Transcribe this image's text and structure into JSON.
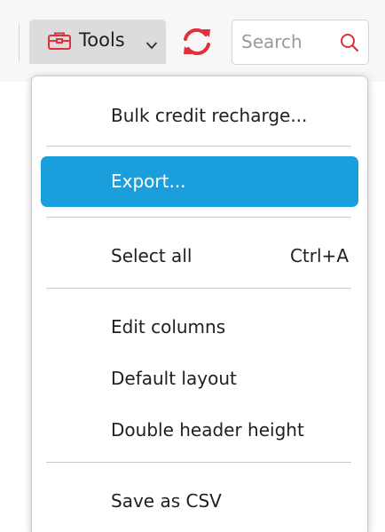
{
  "toolbar": {
    "tools_label": "Tools",
    "search_placeholder": "Search",
    "accent_color": "#e0303a"
  },
  "menu": {
    "highlight_color": "#1a9fdc",
    "items": [
      {
        "label": "Bulk credit recharge...",
        "shortcut": ""
      },
      {
        "label": "Export...",
        "shortcut": "",
        "highlighted": true
      },
      {
        "label": "Select all",
        "shortcut": "Ctrl+A"
      },
      {
        "label": "Edit columns",
        "shortcut": ""
      },
      {
        "label": "Default layout",
        "shortcut": ""
      },
      {
        "label": "Double header height",
        "shortcut": ""
      },
      {
        "label": "Save as CSV",
        "shortcut": ""
      }
    ]
  }
}
